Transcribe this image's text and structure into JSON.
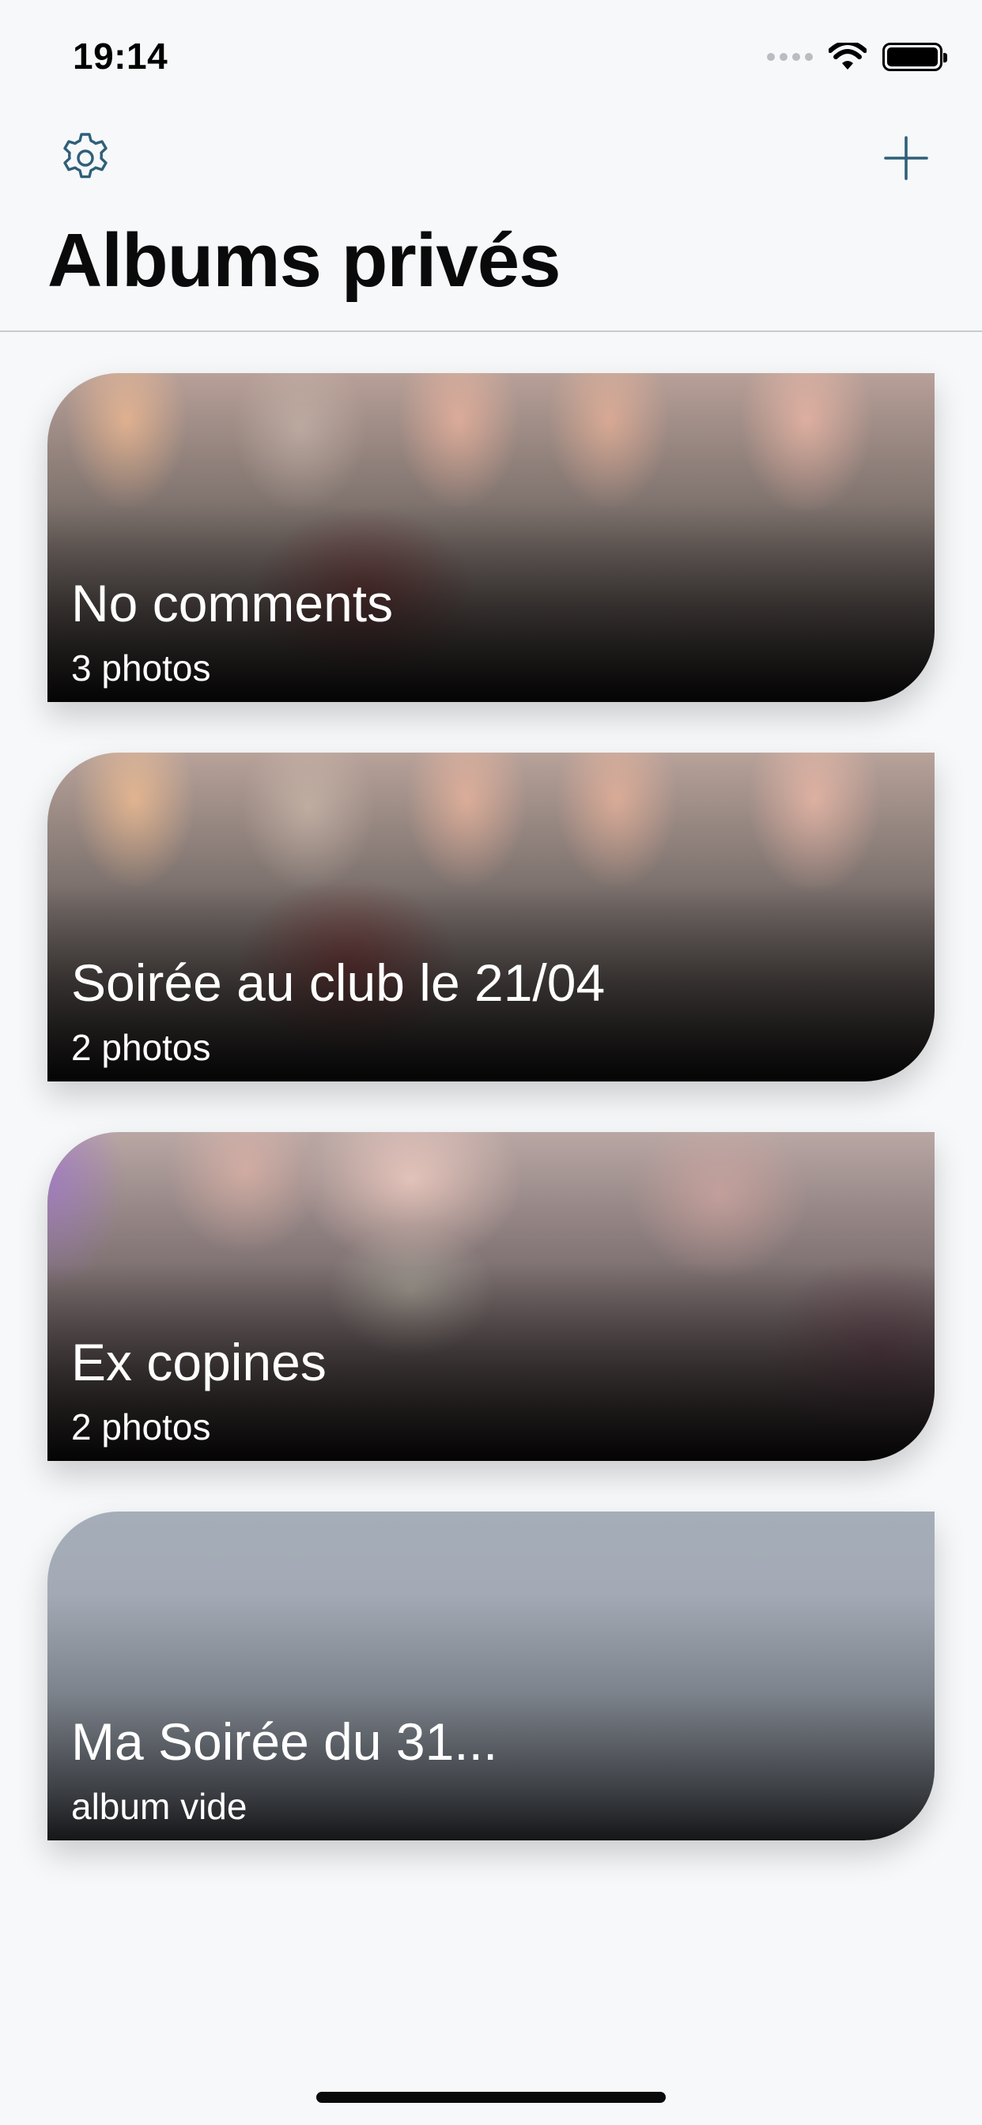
{
  "status_bar": {
    "time": "19:14",
    "icons": [
      "signal-dots-icon",
      "wifi-icon",
      "battery-icon"
    ]
  },
  "nav": {
    "settings_icon": "gear-icon",
    "add_icon": "plus-icon",
    "accent_color": "#2f5f78"
  },
  "page": {
    "title": "Albums privés"
  },
  "albums": [
    {
      "title": "No comments",
      "count": "3 photos"
    },
    {
      "title": "Soirée au club le 21/04",
      "count": "2 photos"
    },
    {
      "title": "Ex copines",
      "count": "2 photos"
    },
    {
      "title": "Ma Soirée du 31...",
      "count": "album vide"
    }
  ]
}
